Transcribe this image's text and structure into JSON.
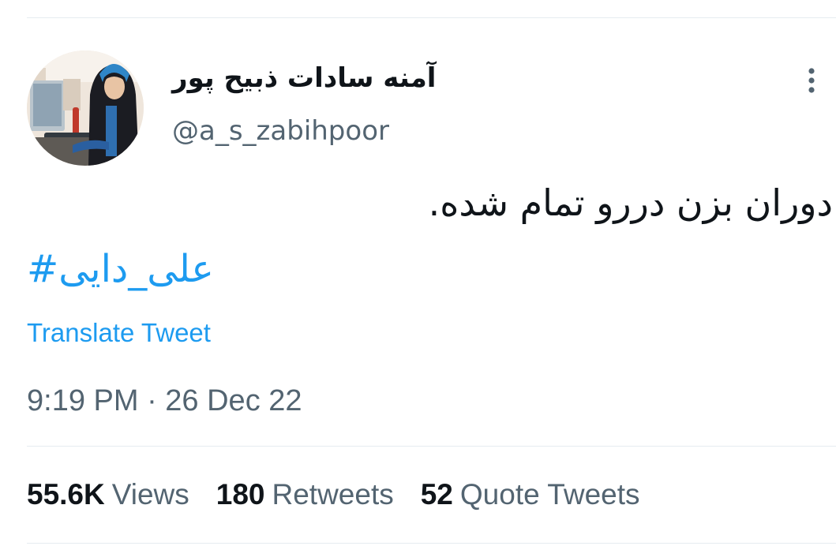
{
  "tweet": {
    "author": {
      "display_name": "آمنه سادات ذبیح پور",
      "handle": "@a_s_zabihpoor"
    },
    "text": "دوران بزن دررو تمام شده.",
    "hashtag": "#علی_دایی",
    "translate_label": "Translate Tweet",
    "timestamp": "9:19 PM · 26 Dec 22",
    "stats": {
      "views": {
        "value": "55.6K",
        "label": "Views"
      },
      "retweets": {
        "value": "180",
        "label": "Retweets"
      },
      "quotes": {
        "value": "52",
        "label": "Quote Tweets"
      }
    }
  },
  "colors": {
    "link": "#1d9bf0",
    "secondary_text": "#536471",
    "primary_text": "#0f1419",
    "divider": "#e6ecf0"
  },
  "icons": {
    "more": "more-vertical-icon"
  }
}
